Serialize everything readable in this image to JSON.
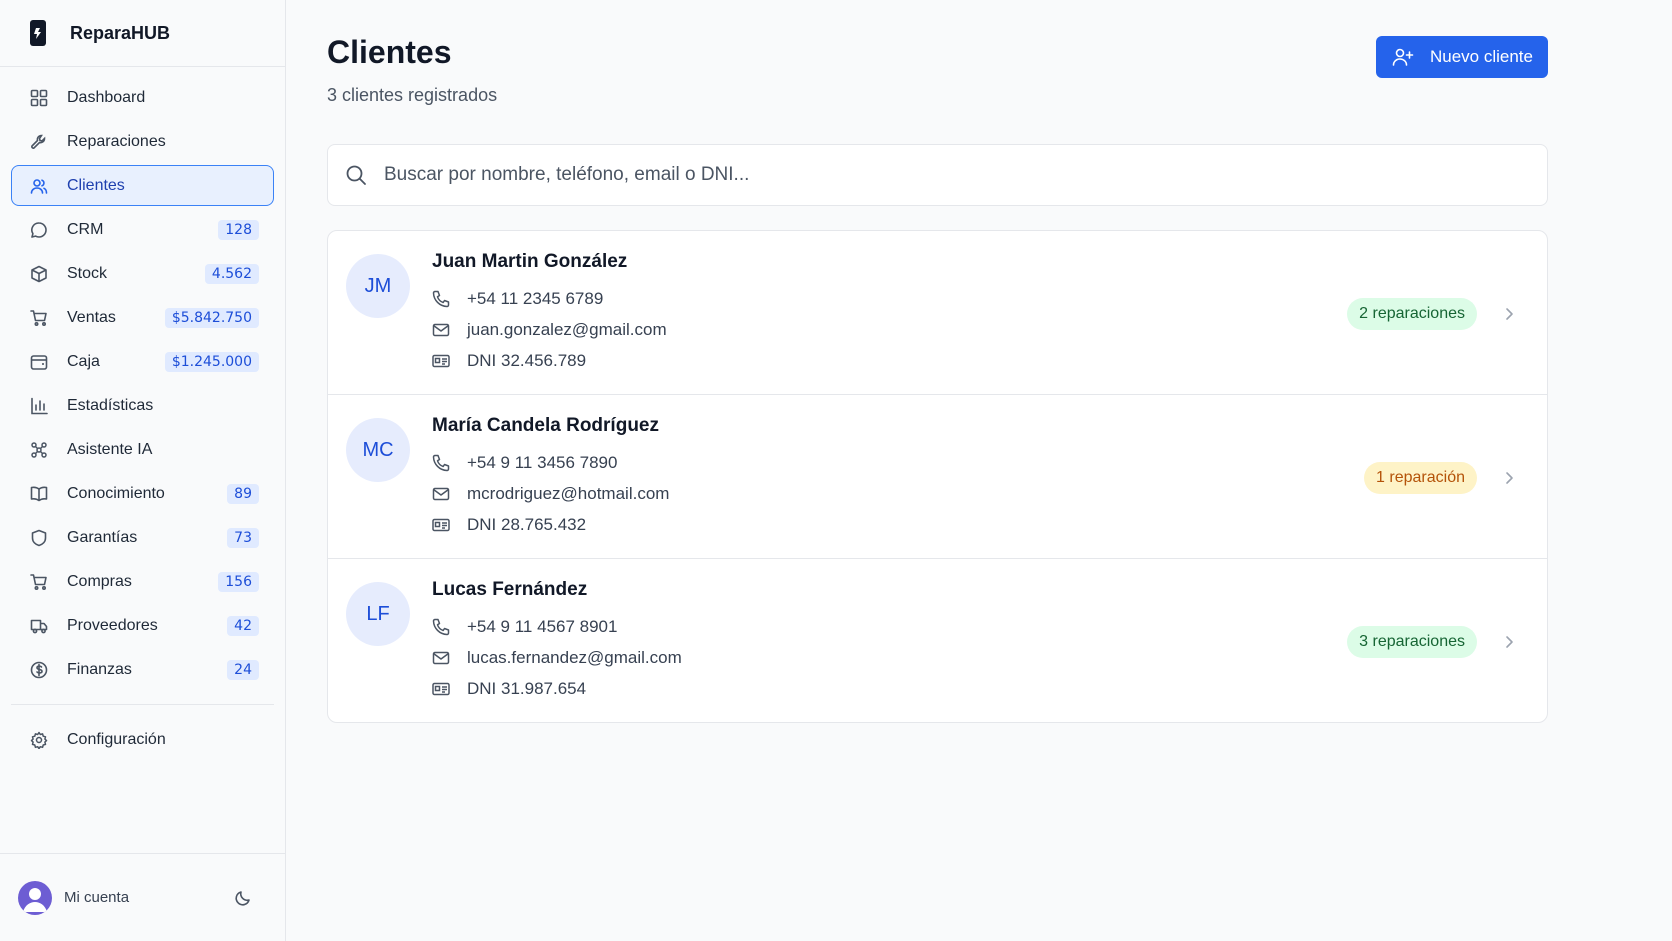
{
  "brand": {
    "name": "ReparaHUB"
  },
  "nav": {
    "items": [
      {
        "label": "Dashboard",
        "badge": ""
      },
      {
        "label": "Reparaciones",
        "badge": ""
      },
      {
        "label": "Clientes",
        "badge": ""
      },
      {
        "label": "CRM",
        "badge": "128"
      },
      {
        "label": "Stock",
        "badge": "4.562"
      },
      {
        "label": "Ventas",
        "badge": "$5.842.750"
      },
      {
        "label": "Caja",
        "badge": "$1.245.000"
      },
      {
        "label": "Estadísticas",
        "badge": ""
      },
      {
        "label": "Asistente IA",
        "badge": ""
      },
      {
        "label": "Conocimiento",
        "badge": "89"
      },
      {
        "label": "Garantías",
        "badge": "73"
      },
      {
        "label": "Compras",
        "badge": "156"
      },
      {
        "label": "Proveedores",
        "badge": "42"
      },
      {
        "label": "Finanzas",
        "badge": "24"
      }
    ],
    "settings_label": "Configuración"
  },
  "account": {
    "label": "Mi cuenta"
  },
  "page": {
    "title": "Clientes",
    "subtitle": "3 clientes registrados",
    "new_button_label": "Nuevo cliente"
  },
  "search": {
    "placeholder": "Buscar por nombre, teléfono, email o DNI..."
  },
  "clients": [
    {
      "initials": "JM",
      "name": "Juan Martin González",
      "phone": "+54 11 2345 6789",
      "email": "juan.gonzalez@gmail.com",
      "dni": "DNI 32.456.789",
      "repairs": "2 reparaciones",
      "repairs_color": "green"
    },
    {
      "initials": "MC",
      "name": "María Candela Rodríguez",
      "phone": "+54 9 11 3456 7890",
      "email": "mcrodriguez@hotmail.com",
      "dni": "DNI 28.765.432",
      "repairs": "1 reparación",
      "repairs_color": "amber"
    },
    {
      "initials": "LF",
      "name": "Lucas Fernández",
      "phone": "+54 9 11 4567 8901",
      "email": "lucas.fernandez@gmail.com",
      "dni": "DNI 31.987.654",
      "repairs": "3 reparaciones",
      "repairs_color": "green"
    }
  ],
  "colors": {
    "accent": "#2563eb",
    "active_bg": "#e8f0fe",
    "green_pill": "#dcfce7",
    "amber_pill": "#fef3c7"
  }
}
